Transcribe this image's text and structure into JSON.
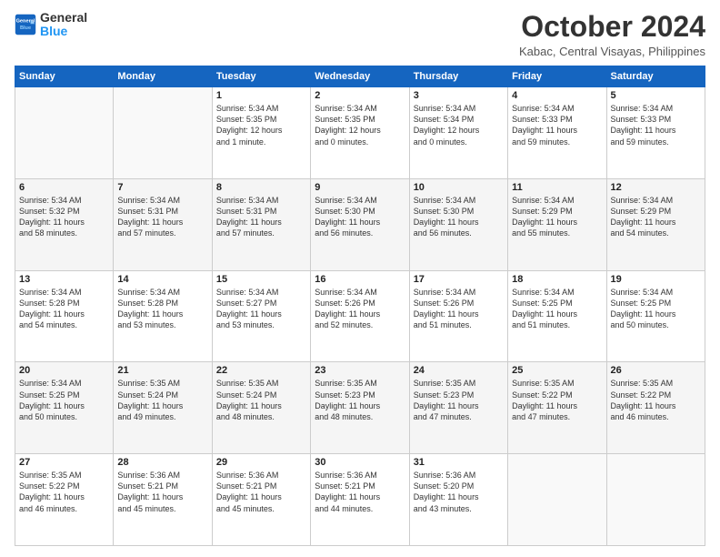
{
  "header": {
    "logo_line1": "General",
    "logo_line2": "Blue",
    "month": "October 2024",
    "location": "Kabac, Central Visayas, Philippines"
  },
  "weekdays": [
    "Sunday",
    "Monday",
    "Tuesday",
    "Wednesday",
    "Thursday",
    "Friday",
    "Saturday"
  ],
  "weeks": [
    [
      {
        "day": "",
        "lines": []
      },
      {
        "day": "",
        "lines": []
      },
      {
        "day": "1",
        "lines": [
          "Sunrise: 5:34 AM",
          "Sunset: 5:35 PM",
          "Daylight: 12 hours",
          "and 1 minute."
        ]
      },
      {
        "day": "2",
        "lines": [
          "Sunrise: 5:34 AM",
          "Sunset: 5:35 PM",
          "Daylight: 12 hours",
          "and 0 minutes."
        ]
      },
      {
        "day": "3",
        "lines": [
          "Sunrise: 5:34 AM",
          "Sunset: 5:34 PM",
          "Daylight: 12 hours",
          "and 0 minutes."
        ]
      },
      {
        "day": "4",
        "lines": [
          "Sunrise: 5:34 AM",
          "Sunset: 5:33 PM",
          "Daylight: 11 hours",
          "and 59 minutes."
        ]
      },
      {
        "day": "5",
        "lines": [
          "Sunrise: 5:34 AM",
          "Sunset: 5:33 PM",
          "Daylight: 11 hours",
          "and 59 minutes."
        ]
      }
    ],
    [
      {
        "day": "6",
        "lines": [
          "Sunrise: 5:34 AM",
          "Sunset: 5:32 PM",
          "Daylight: 11 hours",
          "and 58 minutes."
        ]
      },
      {
        "day": "7",
        "lines": [
          "Sunrise: 5:34 AM",
          "Sunset: 5:31 PM",
          "Daylight: 11 hours",
          "and 57 minutes."
        ]
      },
      {
        "day": "8",
        "lines": [
          "Sunrise: 5:34 AM",
          "Sunset: 5:31 PM",
          "Daylight: 11 hours",
          "and 57 minutes."
        ]
      },
      {
        "day": "9",
        "lines": [
          "Sunrise: 5:34 AM",
          "Sunset: 5:30 PM",
          "Daylight: 11 hours",
          "and 56 minutes."
        ]
      },
      {
        "day": "10",
        "lines": [
          "Sunrise: 5:34 AM",
          "Sunset: 5:30 PM",
          "Daylight: 11 hours",
          "and 56 minutes."
        ]
      },
      {
        "day": "11",
        "lines": [
          "Sunrise: 5:34 AM",
          "Sunset: 5:29 PM",
          "Daylight: 11 hours",
          "and 55 minutes."
        ]
      },
      {
        "day": "12",
        "lines": [
          "Sunrise: 5:34 AM",
          "Sunset: 5:29 PM",
          "Daylight: 11 hours",
          "and 54 minutes."
        ]
      }
    ],
    [
      {
        "day": "13",
        "lines": [
          "Sunrise: 5:34 AM",
          "Sunset: 5:28 PM",
          "Daylight: 11 hours",
          "and 54 minutes."
        ]
      },
      {
        "day": "14",
        "lines": [
          "Sunrise: 5:34 AM",
          "Sunset: 5:28 PM",
          "Daylight: 11 hours",
          "and 53 minutes."
        ]
      },
      {
        "day": "15",
        "lines": [
          "Sunrise: 5:34 AM",
          "Sunset: 5:27 PM",
          "Daylight: 11 hours",
          "and 53 minutes."
        ]
      },
      {
        "day": "16",
        "lines": [
          "Sunrise: 5:34 AM",
          "Sunset: 5:26 PM",
          "Daylight: 11 hours",
          "and 52 minutes."
        ]
      },
      {
        "day": "17",
        "lines": [
          "Sunrise: 5:34 AM",
          "Sunset: 5:26 PM",
          "Daylight: 11 hours",
          "and 51 minutes."
        ]
      },
      {
        "day": "18",
        "lines": [
          "Sunrise: 5:34 AM",
          "Sunset: 5:25 PM",
          "Daylight: 11 hours",
          "and 51 minutes."
        ]
      },
      {
        "day": "19",
        "lines": [
          "Sunrise: 5:34 AM",
          "Sunset: 5:25 PM",
          "Daylight: 11 hours",
          "and 50 minutes."
        ]
      }
    ],
    [
      {
        "day": "20",
        "lines": [
          "Sunrise: 5:34 AM",
          "Sunset: 5:25 PM",
          "Daylight: 11 hours",
          "and 50 minutes."
        ]
      },
      {
        "day": "21",
        "lines": [
          "Sunrise: 5:35 AM",
          "Sunset: 5:24 PM",
          "Daylight: 11 hours",
          "and 49 minutes."
        ]
      },
      {
        "day": "22",
        "lines": [
          "Sunrise: 5:35 AM",
          "Sunset: 5:24 PM",
          "Daylight: 11 hours",
          "and 48 minutes."
        ]
      },
      {
        "day": "23",
        "lines": [
          "Sunrise: 5:35 AM",
          "Sunset: 5:23 PM",
          "Daylight: 11 hours",
          "and 48 minutes."
        ]
      },
      {
        "day": "24",
        "lines": [
          "Sunrise: 5:35 AM",
          "Sunset: 5:23 PM",
          "Daylight: 11 hours",
          "and 47 minutes."
        ]
      },
      {
        "day": "25",
        "lines": [
          "Sunrise: 5:35 AM",
          "Sunset: 5:22 PM",
          "Daylight: 11 hours",
          "and 47 minutes."
        ]
      },
      {
        "day": "26",
        "lines": [
          "Sunrise: 5:35 AM",
          "Sunset: 5:22 PM",
          "Daylight: 11 hours",
          "and 46 minutes."
        ]
      }
    ],
    [
      {
        "day": "27",
        "lines": [
          "Sunrise: 5:35 AM",
          "Sunset: 5:22 PM",
          "Daylight: 11 hours",
          "and 46 minutes."
        ]
      },
      {
        "day": "28",
        "lines": [
          "Sunrise: 5:36 AM",
          "Sunset: 5:21 PM",
          "Daylight: 11 hours",
          "and 45 minutes."
        ]
      },
      {
        "day": "29",
        "lines": [
          "Sunrise: 5:36 AM",
          "Sunset: 5:21 PM",
          "Daylight: 11 hours",
          "and 45 minutes."
        ]
      },
      {
        "day": "30",
        "lines": [
          "Sunrise: 5:36 AM",
          "Sunset: 5:21 PM",
          "Daylight: 11 hours",
          "and 44 minutes."
        ]
      },
      {
        "day": "31",
        "lines": [
          "Sunrise: 5:36 AM",
          "Sunset: 5:20 PM",
          "Daylight: 11 hours",
          "and 43 minutes."
        ]
      },
      {
        "day": "",
        "lines": []
      },
      {
        "day": "",
        "lines": []
      }
    ]
  ]
}
